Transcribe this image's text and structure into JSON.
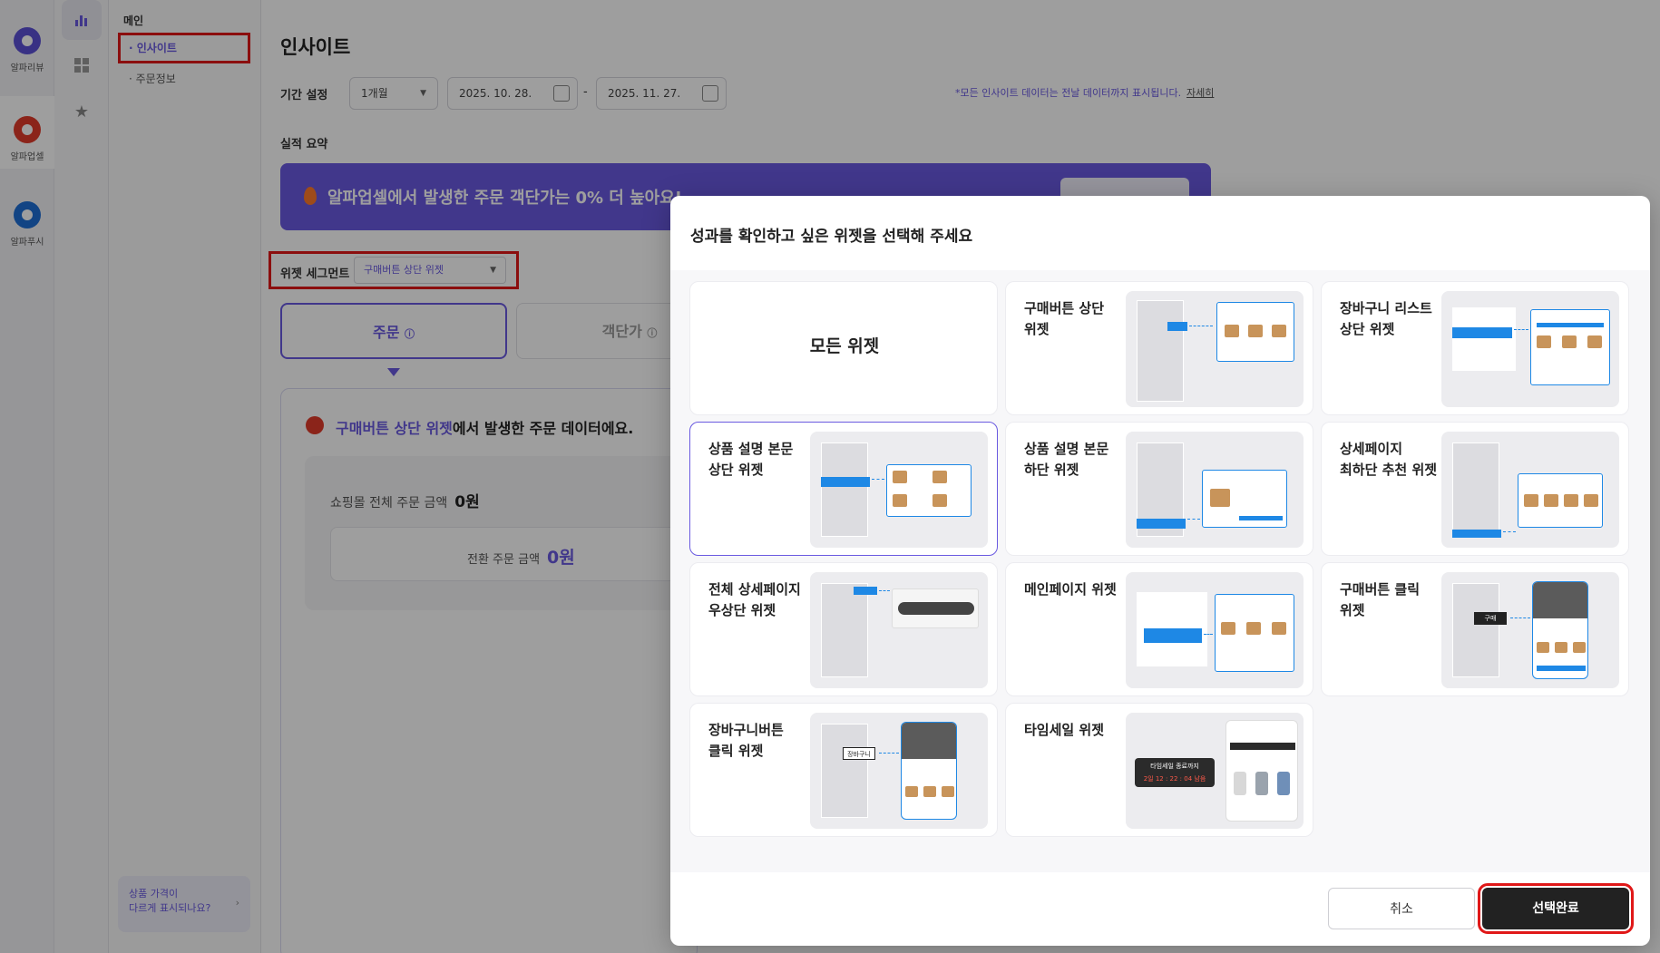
{
  "rail": {
    "apps": [
      {
        "label": "알파리뷰",
        "color": "#5b4fd6"
      },
      {
        "label": "알파업셀",
        "color": "#e03a2a"
      },
      {
        "label": "알파푸시",
        "color": "#1e6fd6"
      }
    ]
  },
  "iconbar": {
    "icons": [
      "bar-chart-icon",
      "dashboard-icon",
      "star-icon"
    ]
  },
  "submenu": {
    "heading": "메인",
    "items": [
      "인사이트",
      "주문정보"
    ],
    "promo": {
      "line1": "상품 가격이",
      "line2": "다르게 표시되나요?"
    }
  },
  "main": {
    "title": "인사이트",
    "period_label": "기간 설정",
    "period_select": "1개월",
    "date_from": "2025. 10. 28.",
    "date_sep": "-",
    "date_to": "2025. 11. 27.",
    "note": "*모든 인사이트 데이터는 전날 데이터까지 표시됩니다.",
    "note_more": "자세히",
    "summary_label": "실적 요약",
    "banner_text": "알파업셀에서 발생한 주문 객단가는 0% 더 높아요!",
    "widget_segment_label": "위젯 세그먼트",
    "widget_segment_value": "구매버튼 상단 위젯",
    "tabs": [
      "주문",
      "객단가"
    ],
    "panel": {
      "highlight": "구매버튼 상단 위젯",
      "rest": "에서 발생한 주문 데이터에요.",
      "total_label": "쇼핑몰 전체 주문 금액",
      "total_value": "0원",
      "conv_label": "전환 주문 금액",
      "conv_value": "0원"
    }
  },
  "modal": {
    "title": "성과를 확인하고 싶은 위젯을 선택해 주세요",
    "cards": [
      {
        "title": "모든 위젯"
      },
      {
        "title": "구매버튼 상단 위젯"
      },
      {
        "title": "장바구니 리스트 상단 위젯"
      },
      {
        "title": "상품 설명 본문 상단 위젯"
      },
      {
        "title": "상품 설명 본문 하단 위젯"
      },
      {
        "title": "상세페이지 최하단 추천 위젯"
      },
      {
        "title": "전체 상세페이지 우상단 위젯"
      },
      {
        "title": "메인페이지 위젯"
      },
      {
        "title": "구매버튼 클릭 위젯"
      },
      {
        "title": "장바구니버튼 클릭 위젯"
      },
      {
        "title": "타임세일 위젯"
      }
    ],
    "mock_labels": {
      "buy": "구매",
      "cart": "장바구니",
      "timesale": "타임세일 종료까지",
      "timesale_time": "2일 12 : 22 : 04 남음"
    },
    "cancel_label": "취소",
    "confirm_label": "선택완료"
  },
  "colors": {
    "accent": "#6a5ae0",
    "highlight_box": "#e01818",
    "widget_blue": "#1e88e5"
  }
}
